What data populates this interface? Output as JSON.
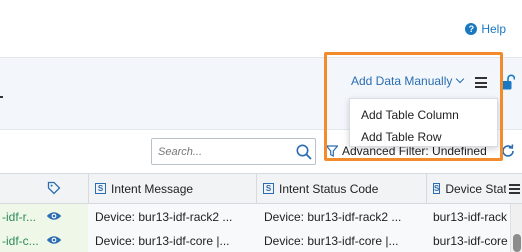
{
  "header": {
    "help_label": "Help"
  },
  "toolbar": {
    "add_data_label": "Add Data Manually",
    "menu": {
      "items": [
        {
          "label": "Add Table Column"
        },
        {
          "label": "Add Table Row"
        }
      ]
    }
  },
  "filters": {
    "search_placeholder": "Search...",
    "advanced_filter_label": "Advanced Filter: Undefined"
  },
  "table": {
    "columns": [
      {
        "label": "Intent Message",
        "badge": "S"
      },
      {
        "label": "Intent Status Code",
        "badge": "S"
      },
      {
        "label": "Device Stat",
        "badge": "S"
      }
    ],
    "rows": [
      {
        "id": "-idf-r...",
        "intent_message": "Device: bur13-idf-rack2 ...",
        "intent_status_code": "Device: bur13-idf-rack2 ...",
        "device_status": "bur13-idf-rack"
      },
      {
        "id": "-idf-c...",
        "intent_message": "Device: bur13-idf-core |...",
        "intent_status_code": "Device: bur13-idf-core |...",
        "device_status": "bur13-idf-core"
      }
    ]
  },
  "colors": {
    "accent": "#2a6db0",
    "highlight_border": "#f28b2b",
    "id_text": "#2e8b57",
    "toolbar_bg": "#f3f7fc"
  },
  "icons": [
    "help-icon",
    "chevron-down-icon",
    "hamburger-menu-icon",
    "unlock-icon",
    "search-icon",
    "filter-icon",
    "refresh-icon",
    "tag-icon",
    "eye-icon"
  ]
}
